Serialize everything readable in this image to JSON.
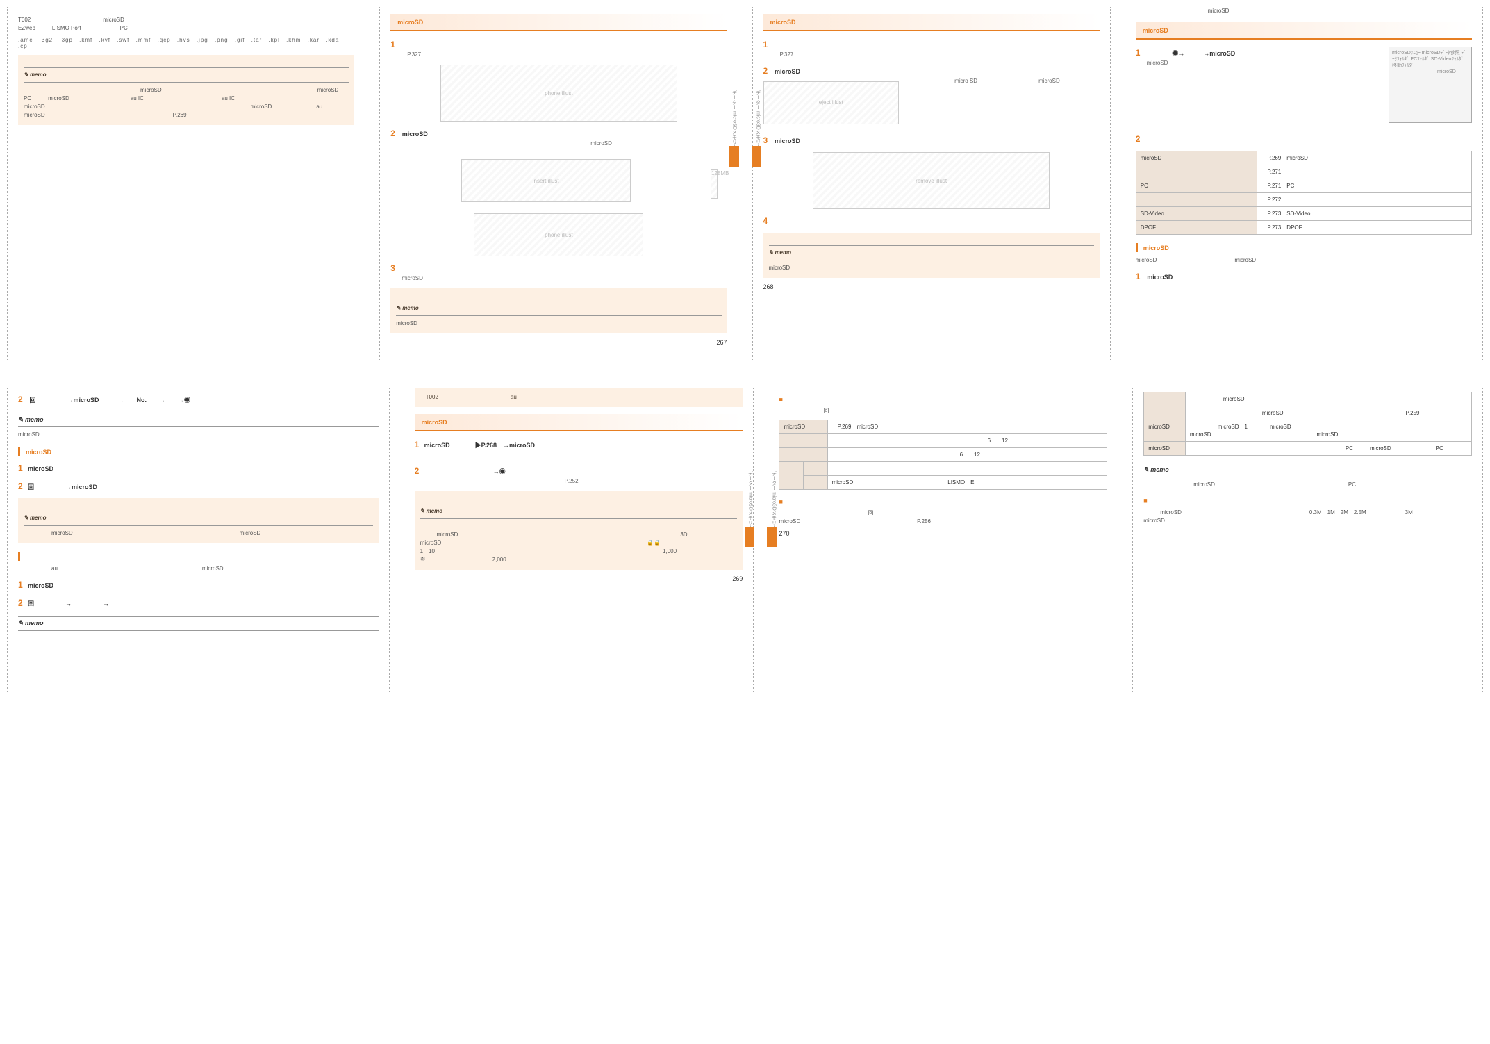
{
  "sidebar_label": "データー microSDメモリーカード",
  "page_numbers": {
    "p267": "267",
    "p268": "268",
    "p269": "269",
    "p270": "270"
  },
  "spread1": {
    "col1": {
      "intro_masked": "　　　　　　　　　　　　　　　　　",
      "t002_text": "T002　　　　　　　　　　　　　microSD　　　　　　　　　　　　　　　　　　　　　　　　　　　　　　　　　　　　　　　　　　　EZweb　　　LISMO Port　　　　　　　PC　　　　　　　　　　　　　　　　　　　　　　　　　　　　　　　　　　　　　　　　　　　　　　　　　",
      "ext_list": ".amc .3g2 .3gp .kmf .kvf .swf .mmf .qcp .hvs .jpg .png .gif .tar .kpl .khm .kar .kda .cpl",
      "memo_title": "memo",
      "memo_body": "　　　　　　　　　　　　　　　　　　　　　microSD　　　　　　　　　　　　　　　　　　　　　　　　　　　　microSD　　　　　　　　　　　　　　　　　　　PC　　　microSD　　　　　　　　　　　au IC　　　　　　　　　　　　　　au IC　　　　　　　　　　　　　　　　　　　microSD　　　　　　　　　　　　　　　　　　　　　　　　　　　　　　　　　　　　　microSD　　　　　　　　au　　　　　　　　　microSD　　　　　　　　　　　　　　　　　　　　　　　P.269"
    },
    "col2": {
      "h1": "microSD　　　　　　　　　",
      "step1_t": "　　　　　　　　　　　　　　　",
      "step1_s": "　P.327　　　　　　　　　",
      "step2_t": "microSD　　　　　　　　　　　　　　　　　　　　　　　　",
      "step2_body": "　　　　　　　　　　　　　　　　　　　　　　　　　　　　　　　　　　microSD　　　　　　　　　　　　　　　",
      "fig_label": "　　　",
      "step3_t": "　　　　　　　　　　　　　　　",
      "step3_s": "microSD　　　　　　　　　　　　　　　　　　　　　　　　　　",
      "memo_title": "memo",
      "memo_body": "microSD　　　　　　　　　　　　　　　　　　　　　　　　　　　　　　"
    },
    "col3": {
      "h1": "microSD　　　　　　　　　",
      "step1_t": "　　　　　　　　　　　　　　　",
      "step1_s": "　P.327　　　　　　　　　",
      "step2_t": "microSD　　　　　　　　　　　　　　　",
      "step2_body": "　　　　　　　　　micro SD　　　　　　　　　　　microSD　　　　　　　　　　　　　　　　　",
      "step3_t": "microSD　　　　　　　　　　　　　　　　　",
      "step4_t": "　　　　　　　　　　　　　　　",
      "memo_title": "memo",
      "memo_body": "microSD　　　　　　　　　　　　　　　　　　　　　　　　　　　　　　"
    },
    "col4": {
      "intro": "　　　　　　　　　　　　　microSD　　　　　　　　　　　　　　　　　　　　　　",
      "h1": "microSD　　　　　　",
      "step1_t": "　　　　◉→　　　→microSD　",
      "step1_s": "microSD　　　　　　　　　　",
      "panel_lines": "microSDﾒﾆｭｰ\nmicroSDﾃﾞｰﾀ参照\nﾃﾞｰﾀﾌｫﾙﾀﾞ\nPCﾌｫﾙﾀﾞ\nSD-Videoﾌｫﾙﾀﾞ\n移動ﾌｫﾙﾀﾞ\n\n　　　　　　　　　\nmicroSD　　",
      "step2_t": "",
      "table_rows": [
        {
          "k": "microSD　　　",
          "v": "　P.269　microSD　　　　　"
        },
        {
          "k": "　　　　",
          "v": "　P.271　　　　　　　　　"
        },
        {
          "k": "PC　　　",
          "v": "　P.271　PC　　　　　　　"
        },
        {
          "k": "　　　　",
          "v": "　P.272　　　　　　　　　"
        },
        {
          "k": "SD-Video　　",
          "v": "　P.273　SD-Video　　　　"
        },
        {
          "k": "DPOF　　",
          "v": "　P.273　DPOF　　　　　"
        }
      ],
      "h2": "microSD　　　　　　　　　　",
      "h2_body": "microSD　　　　　　　　　　　　　　microSD　　　　　　　　　　　　　　　　　　　　　　",
      "h2_step1": "microSD　　　"
    }
  },
  "spread2": {
    "col1": {
      "step2_t": "回　　　　　→microSD　　　→　　No.　　→　　→◉",
      "memo1_title": "memo",
      "memo1_body": "microSD　　　　　　　　　　　　　　　　　　　　　　　　　　　　",
      "h2a": "microSD　　　　　　　　　　　　　",
      "h2a_step1": "microSD　　　",
      "h2a_step2": "回　　　　　→microSD　　　　",
      "memo2_title": "memo",
      "memo2_body": "　　　　　microSD　　　　　　　　　　　　　　　　　　　　　　　　　　　　　　microSD　　　　　　　",
      "h2b": "　　　　　　　　　　",
      "h2b_body": "　　　　　　au　　　　　　　　　　　　　　　　　　　　　　　　　　microSD　　　　　　　　　　　　　　　　　　　　　　　　　　　　　　　　　　　　　　　　　　　　　　　　　　　　　　　　　　　　　",
      "h2b_step1": "microSD　　　",
      "h2b_step2": "回　　　　　→　　　　　→　　　",
      "memo3_title": "memo",
      "memo3_body": "　　　　　　　　　　　　　　　　　　　　　　　　　　　　　　　　　　　"
    },
    "col2": {
      "note_top": "　T002　　　　　　　　　　　　　au　　　　　　　　　　　　　　　　",
      "h1": "microSD　　　　　　　　　　　　　　　　　",
      "step1_t": "microSD　　　　▶P.268　→microSD　　　　　",
      "step1_s": "　　　　　　　　",
      "step2_t": "　　　　　　　　　　　→◉",
      "step2_s": "　　　　　　　　　　　　　　　　　　　　　　　　　P.252　　　　　　",
      "memo_title": "memo",
      "memo_body": "　　　　　　　　　　　　　　　　　　　　　　　　　　　　　\n　　　microSD　　　　　　　　　　　　　　　　　　　　　　　　　　　　　　　　　　　　　　　　3D　　　　　　　　　　　　　　　　　　　　　　　　　　　　　　　　　　　　　　　　　　　　　　　　　　microSD　　　　　　　　　　　　　　　　　　　　　　　　　　　　　　　　　　　　　🔒🔒　　　　　　　　　　　　　　　　　　　　　1　10　　　　　　　　　　　　　　　　　　　　　　　　　　　　　　　　　　　　　　　　　1,000　　　　　　　　　　　　　　　　　　　　　　※　　　　　　　　　　　　2,000　　　　　　"
    },
    "col3": {
      "sq1": "　　　　　　　　　　　　　",
      "sq1_body": "　　　　　　　　回　　　　　　　　　　　　　　　　　　　　　　　　　　　　　　　　　　　",
      "table_rows": [
        {
          "k": "microSD　　　",
          "v": "　P.269　microSD　　　　　"
        },
        {
          "k": "　　　　　　",
          "v": "　　　　　　　　　　　　　　　　　　　　　　　　　　　　6　　12　　　　　　　　"
        },
        {
          "k": "　　　　　　",
          "v": "　　　　　　　　　　　　　　　　　　　　　　　6　　12　　"
        },
        {
          "k": "　　",
          "k2": "　　",
          "v": "　　　　　　　　　　　　　　　　"
        },
        {
          "k": "",
          "k2": "　　",
          "v": "microSD　　　　　　　　　　　　　　　　　LISMO　E　　　　　　　　　　　　　　　　　　　　　　"
        }
      ],
      "sq2": "　　　　　　　　　　　　　　　",
      "sq2_body": "　　　　　　　　　　　　　　　　回　　　　　　　　　　　　　　　　　　　　　　　　　　　　　　　　　　　　　　　　　　microSD　　　　　　　　　　　　　　　　　　　　　P.256　　　　　　　"
    },
    "col4": {
      "table_rows": [
        {
          "k": "　　　",
          "v": "　　　　　　microSD　　　　　　　　　　　　　　　　　　　　　　　　　　　　　　　　　　　　　　"
        },
        {
          "k": "　　",
          "v": "　　　　　　　　　　　　　microSD　　　　　　　　　　　　　　　　　　　　　　P.259　　　　　　　　　　　　　"
        },
        {
          "k": "microSD　　",
          "v": "　　　　　microSD　1　　　　microSD　　　　　　　　　　　　　　　　　　　　　　　　　　　　　　　　　　　microSD　　　　　　　　　　　　　　　　　　　microSD　　"
        },
        {
          "k": "microSD　　",
          "v": "　　　　　　　　　　　　　　　　　　　　　　　　　　　　PC　　　microSD　　　　　　　　PC　　　　　　　　　　"
        }
      ],
      "memo_title": "memo",
      "memo_body": "　　　　　　　　　microSD　　　　　　　　　　　　　　　　　　　　　　　　PC　　　　　　　　　　　　",
      "sq": "　　　　　　　　　",
      "sq_body": "　　　microSD　　　　　　　　　　　　　　　　　　　　　　　0.3M　1M　2M　2.5M　　　　　　　3M　　　　　　　　　　　　　　　　　　　microSD　　　　　"
    }
  }
}
